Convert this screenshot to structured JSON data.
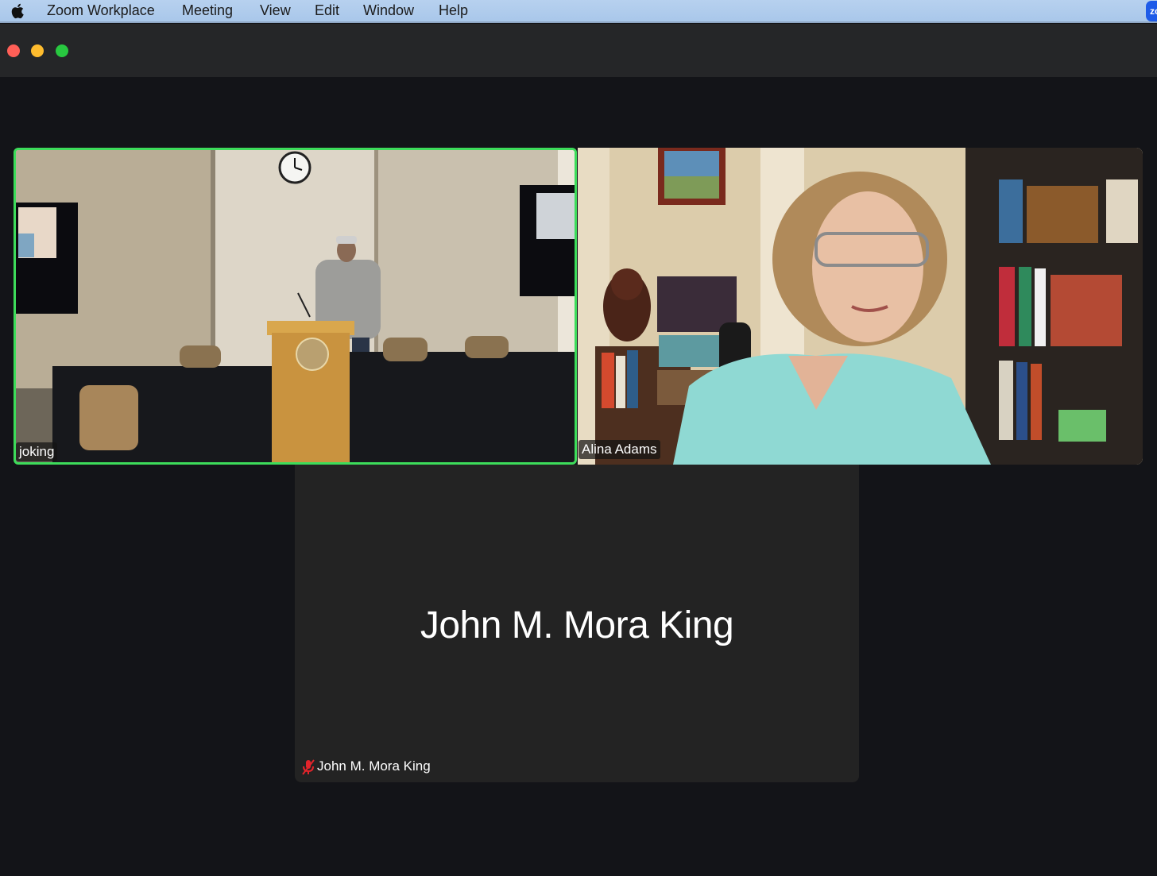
{
  "menubar": {
    "app_name": "Zoom Workplace",
    "items": [
      "Meeting",
      "View",
      "Edit",
      "Window",
      "Help"
    ],
    "status_icon_text": "zc"
  },
  "window": {
    "buttons": [
      "close",
      "minimize",
      "zoom"
    ]
  },
  "participants": [
    {
      "name": "joking",
      "active_speaker": true,
      "video": true,
      "highlight_color": "#3ddc5a"
    },
    {
      "name": "Alina Adams",
      "active_speaker": false,
      "video": true
    },
    {
      "name": "John M. Mora King",
      "display_name": "John M. Mora King",
      "video": false,
      "muted": true,
      "muted_icon": "muted-mic-icon"
    }
  ]
}
